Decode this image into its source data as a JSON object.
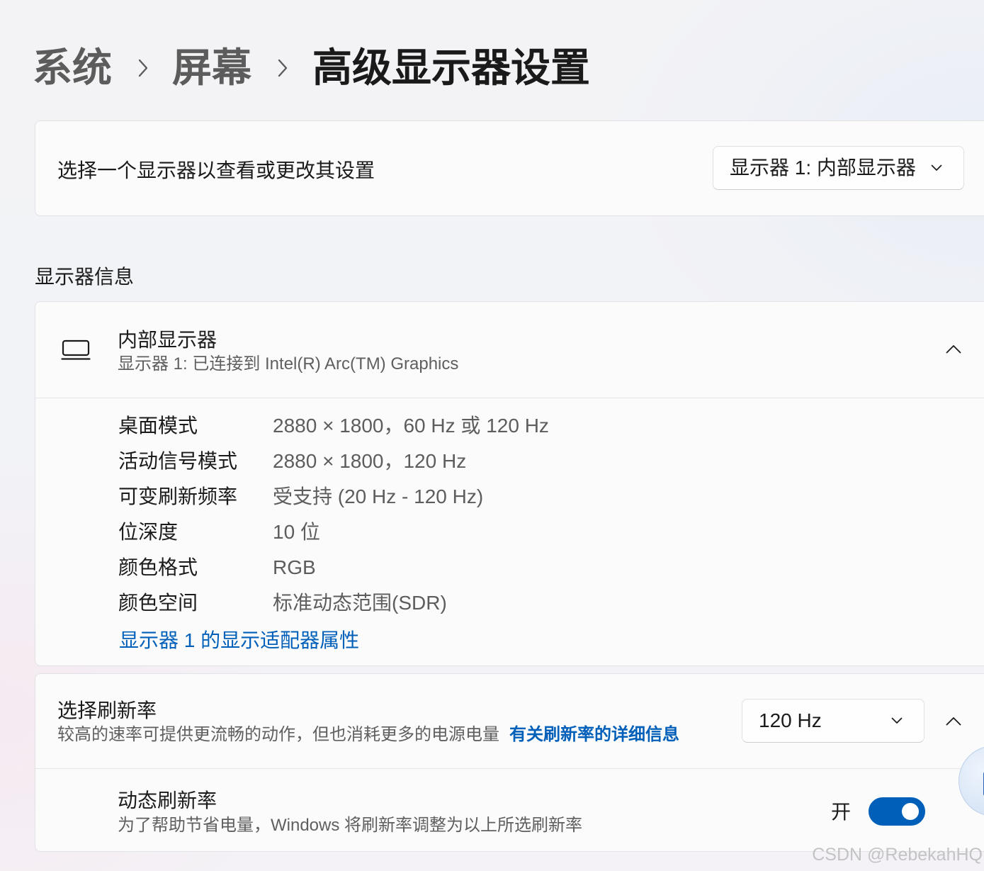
{
  "breadcrumb": {
    "items": [
      "系统",
      "屏幕"
    ],
    "current": "高级显示器设置"
  },
  "display_selector": {
    "label": "选择一个显示器以查看或更改其设置",
    "selected": "显示器 1: 内部显示器"
  },
  "section_heading": "显示器信息",
  "display_info": {
    "title": "内部显示器",
    "subtitle": "显示器 1: 已连接到 Intel(R) Arc(TM) Graphics",
    "expanded": true,
    "rows": [
      {
        "label": "桌面模式",
        "value": "2880 × 1800，60 Hz 或 120 Hz"
      },
      {
        "label": "活动信号模式",
        "value": "2880 × 1800，120 Hz"
      },
      {
        "label": "可变刷新频率",
        "value": "受支持 (20 Hz - 120 Hz)"
      },
      {
        "label": "位深度",
        "value": "10 位"
      },
      {
        "label": "颜色格式",
        "value": "RGB"
      },
      {
        "label": "颜色空间",
        "value": "标准动态范围(SDR)"
      }
    ],
    "adapter_link": "显示器 1 的显示适配器属性"
  },
  "refresh_rate": {
    "title": "选择刷新率",
    "description": "较高的速率可提供更流畅的动作，但也消耗更多的电源电量",
    "link": "有关刷新率的详细信息",
    "selected": "120 Hz",
    "expanded": true,
    "dynamic": {
      "title": "动态刷新率",
      "description": "为了帮助节省电量，Windows 将刷新率调整为以上所选刷新率",
      "state_label": "开",
      "enabled": true
    }
  },
  "watermark": "CSDN @RebekahHQ",
  "icons": {
    "breadcrumb_separator": "chevron-right-icon",
    "dropdown": "chevron-down-icon",
    "expander": "chevron-up-icon",
    "display": "laptop-icon"
  },
  "colors": {
    "accent": "#005fb8",
    "text_primary": "#1b1b1b",
    "text_secondary": "#5f5f5f",
    "card_background": "#fbfbfc"
  }
}
